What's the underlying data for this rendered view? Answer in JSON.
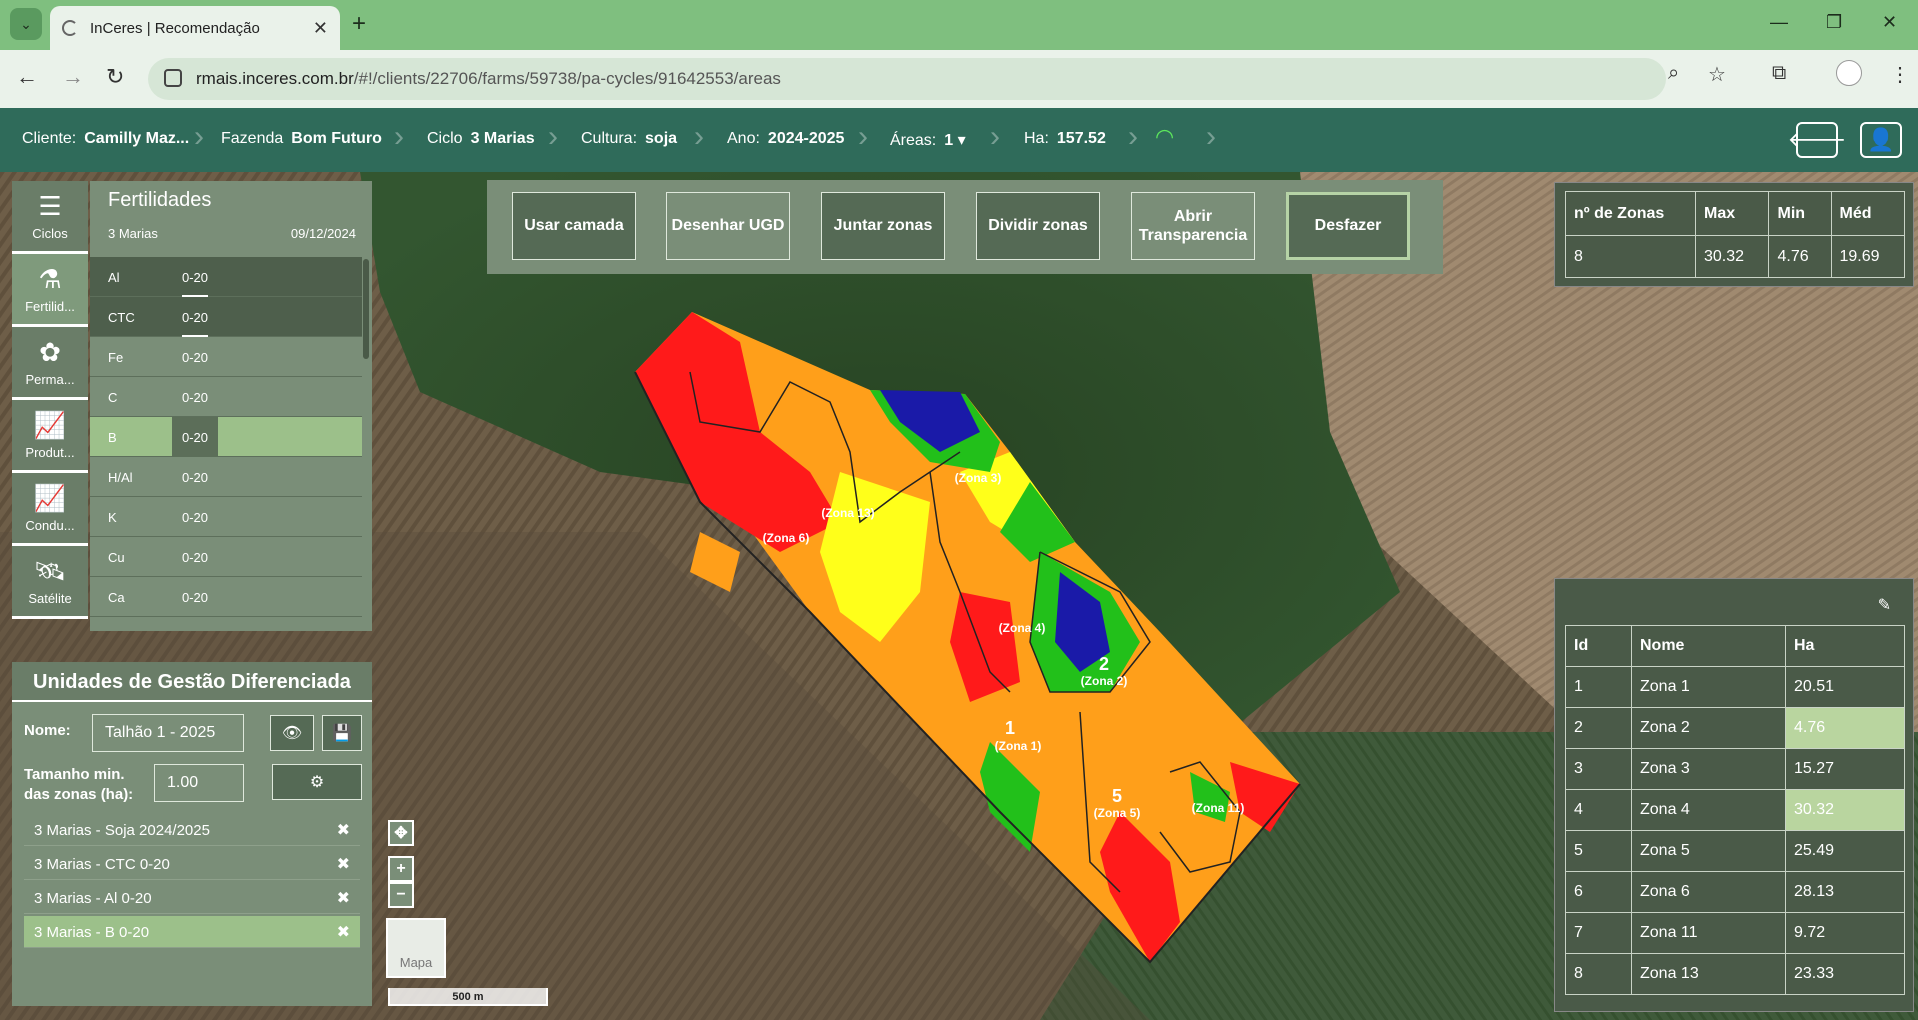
{
  "browser": {
    "tab_title": "InCeres | Recomendação",
    "url_host": "rmais.inceres.com.br",
    "url_path": "/#!/clients/22706/farms/59738/pa-cycles/91642553/areas"
  },
  "header": {
    "cliente_label": "Cliente:",
    "cliente_value": "Camilly Maz...",
    "fazenda_label": "Fazenda",
    "fazenda_value": "Bom Futuro",
    "ciclo_label": "Ciclo",
    "ciclo_value": "3 Marias",
    "cultura_label": "Cultura:",
    "cultura_value": "soja",
    "ano_label": "Ano:",
    "ano_value": "2024-2025",
    "areas_label": "Áreas:",
    "areas_value": "1",
    "ha_label": "Ha:",
    "ha_value": "157.52"
  },
  "sidenav": [
    {
      "label": "Ciclos",
      "icon": "list-icon"
    },
    {
      "label": "Fertilid...",
      "icon": "flask-icon"
    },
    {
      "label": "Perma...",
      "icon": "plants-icon"
    },
    {
      "label": "Produt...",
      "icon": "chart-line-icon"
    },
    {
      "label": "Condu...",
      "icon": "chart-line-icon"
    },
    {
      "label": "Satélite",
      "icon": "satellite-icon"
    }
  ],
  "fertilidades": {
    "title": "Fertilidades",
    "subtitle": "3 Marias",
    "date": "09/12/2024",
    "rows": [
      {
        "name": "Al",
        "depth": "0-20"
      },
      {
        "name": "CTC",
        "depth": "0-20"
      },
      {
        "name": "Fe",
        "depth": "0-20"
      },
      {
        "name": "C",
        "depth": "0-20"
      },
      {
        "name": "B",
        "depth": "0-20"
      },
      {
        "name": "H/Al",
        "depth": "0-20"
      },
      {
        "name": "K",
        "depth": "0-20"
      },
      {
        "name": "Cu",
        "depth": "0-20"
      },
      {
        "name": "Ca",
        "depth": "0-20"
      }
    ]
  },
  "toolbar": {
    "usar_camada": "Usar camada",
    "desenhar_ugd": "Desenhar UGD",
    "juntar_zonas": "Juntar zonas",
    "dividir_zonas": "Dividir zonas",
    "abrir_transparencia": "Abrir Transparencia",
    "desfazer": "Desfazer"
  },
  "stats": {
    "headers": [
      "nº de Zonas",
      "Max",
      "Min",
      "Méd"
    ],
    "values": [
      "8",
      "30.32",
      "4.76",
      "19.69"
    ]
  },
  "zones": {
    "headers": [
      "Id",
      "Nome",
      "Ha"
    ],
    "rows": [
      {
        "id": "1",
        "nome": "Zona 1",
        "ha": "20.51"
      },
      {
        "id": "2",
        "nome": "Zona 2",
        "ha": "4.76"
      },
      {
        "id": "3",
        "nome": "Zona 3",
        "ha": "15.27"
      },
      {
        "id": "4",
        "nome": "Zona 4",
        "ha": "30.32"
      },
      {
        "id": "5",
        "nome": "Zona 5",
        "ha": "25.49"
      },
      {
        "id": "6",
        "nome": "Zona 6",
        "ha": "28.13"
      },
      {
        "id": "7",
        "nome": "Zona 11",
        "ha": "9.72"
      },
      {
        "id": "8",
        "nome": "Zona 13",
        "ha": "23.33"
      }
    ]
  },
  "ugd": {
    "title": "Unidades de Gestão Diferenciada",
    "nome_label": "Nome:",
    "nome_value": "Talhão 1 - 2025",
    "tamanho_label_1": "Tamanho min.",
    "tamanho_label_2": "das zonas (ha):",
    "tamanho_value": "1.00",
    "layers": [
      "3 Marias - Soja 2024/2025",
      "3 Marias - CTC 0-20",
      "3 Marias - Al 0-20",
      "3 Marias - B 0-20"
    ]
  },
  "map": {
    "zone_labels": [
      {
        "num": "6",
        "name": "(Zona 6)"
      },
      {
        "num": "13",
        "name": "(Zona 13)"
      },
      {
        "num": "3",
        "name": "(Zona 3)"
      },
      {
        "num": "4",
        "name": "(Zona 4)"
      },
      {
        "num": "2",
        "name": "(Zona 2)"
      },
      {
        "num": "1",
        "name": "(Zona 1)"
      },
      {
        "num": "5",
        "name": "(Zona 5)"
      },
      {
        "num": "11",
        "name": "(Zona 11)"
      }
    ],
    "basemap_label": "Mapa",
    "scale_label": "500 m"
  },
  "colors": {
    "header_bg": "#2f6b5a",
    "panel_bg": "#7a8e78",
    "selected": "#9cc08a",
    "heat_red": "#ff1a1a",
    "heat_orange": "#ff9f1a",
    "heat_yellow": "#ffff1a",
    "heat_green": "#22c01a",
    "heat_blue": "#1a1aa8"
  }
}
